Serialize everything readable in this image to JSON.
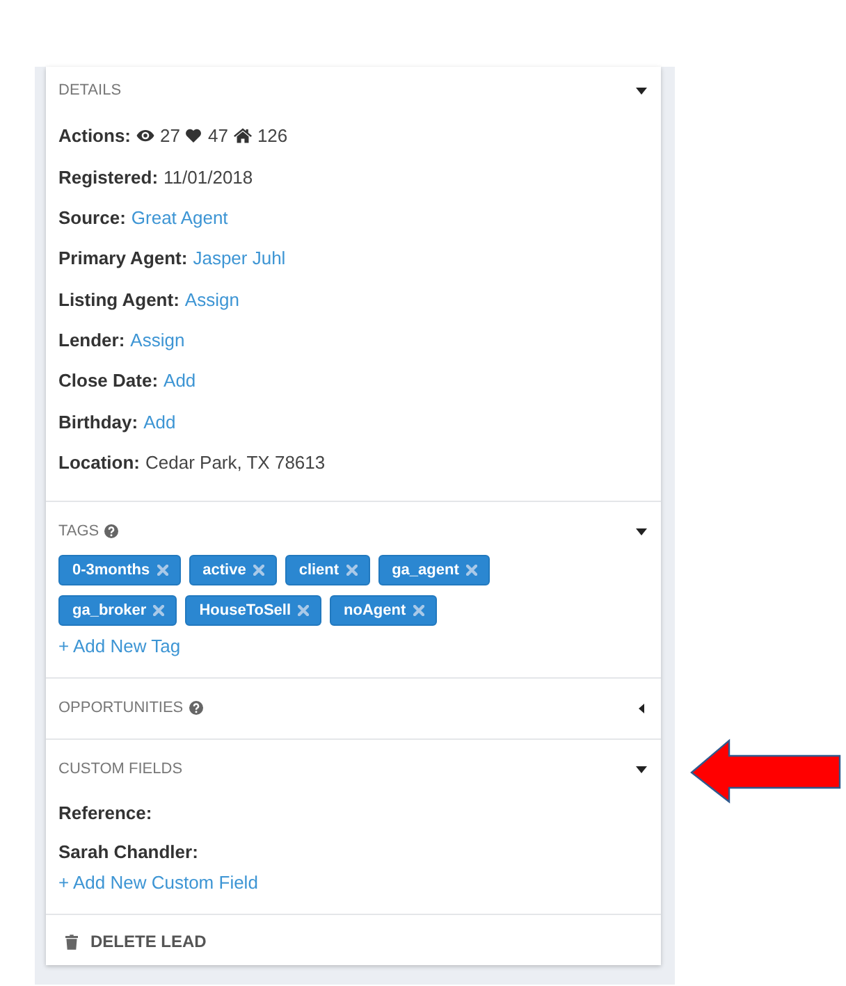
{
  "sections": [
    {
      "kind": "details",
      "title": "DETAILS",
      "help": false,
      "expanded": true,
      "rows": [
        {
          "kind": "counts",
          "label": "Actions:",
          "counts": [
            "27",
            "47",
            "126"
          ]
        },
        {
          "kind": "text",
          "label": "Registered:",
          "value": "11/01/2018"
        },
        {
          "kind": "link",
          "label": "Source:",
          "value": "Great Agent"
        },
        {
          "kind": "link",
          "label": "Primary Agent:",
          "value": "Jasper Juhl"
        },
        {
          "kind": "link",
          "label": "Listing Agent:",
          "value": "Assign"
        },
        {
          "kind": "link",
          "label": "Lender:",
          "value": "Assign"
        },
        {
          "kind": "link",
          "label": "Close Date:",
          "value": "Add"
        },
        {
          "kind": "link",
          "label": "Birthday:",
          "value": "Add"
        },
        {
          "kind": "text",
          "label": "Location:",
          "value": "Cedar Park, TX 78613"
        }
      ]
    },
    {
      "kind": "tags",
      "title": "TAGS",
      "help": true,
      "expanded": true,
      "tags": [
        {
          "label": "0-3months"
        },
        {
          "label": "active"
        },
        {
          "label": "client"
        },
        {
          "label": "ga_agent"
        },
        {
          "label": "ga_broker"
        },
        {
          "label": "HouseToSell"
        },
        {
          "label": "noAgent"
        }
      ],
      "add_link": "+ Add New Tag"
    },
    {
      "kind": "opportunities",
      "title": "OPPORTUNITIES",
      "help": true,
      "expanded": false
    },
    {
      "kind": "custom_fields",
      "title": "CUSTOM FIELDS",
      "help": false,
      "expanded": true,
      "fields": [
        {
          "label": "Reference:"
        },
        {
          "label": "Sarah Chandler:"
        }
      ],
      "add_link": "+ Add New Custom Field"
    }
  ],
  "delete_button": {
    "label": "DELETE LEAD"
  }
}
